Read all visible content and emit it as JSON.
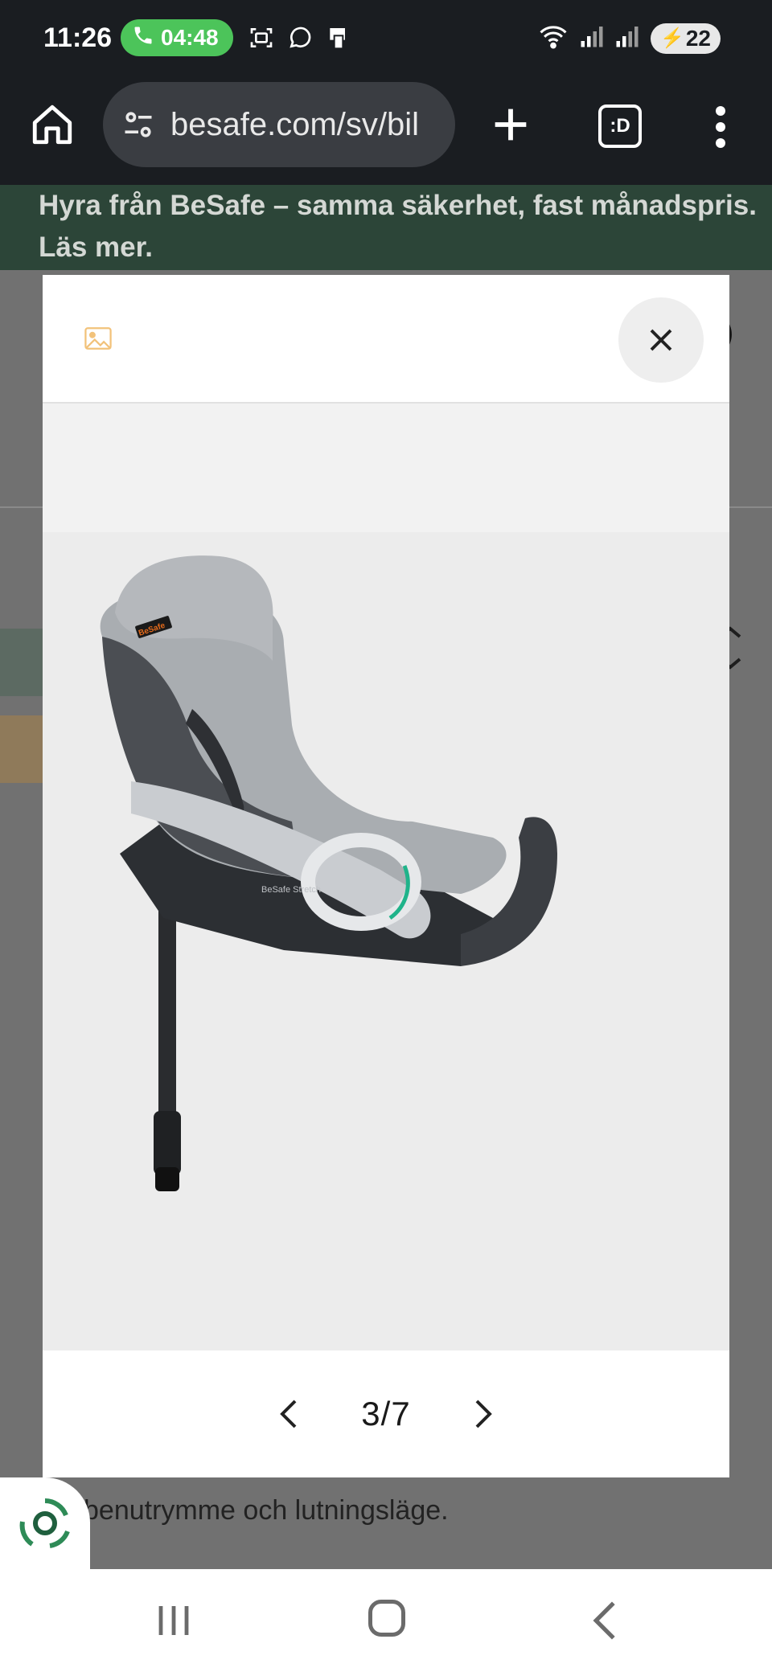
{
  "status_bar": {
    "time": "11:26",
    "call_timer": "04:48",
    "battery": "22"
  },
  "browser": {
    "url": "besafe.com/sv/bil",
    "tabs_label": ":D"
  },
  "page": {
    "banner_text": "Hyra från BeSafe – samma säkerhet, fast månadspris. Läs mer.",
    "under_text": "benutrymme och lutningsläge."
  },
  "modal": {
    "image_alt": "BeSafe Stretch",
    "seat_logo": "BeSafe",
    "base_label": "BeSafe Stretch",
    "pager": "3/7"
  },
  "colors": {
    "accent_green": "#4cc45a",
    "banner_green": "#2c4538",
    "seat_gray": "#a9adb1"
  }
}
